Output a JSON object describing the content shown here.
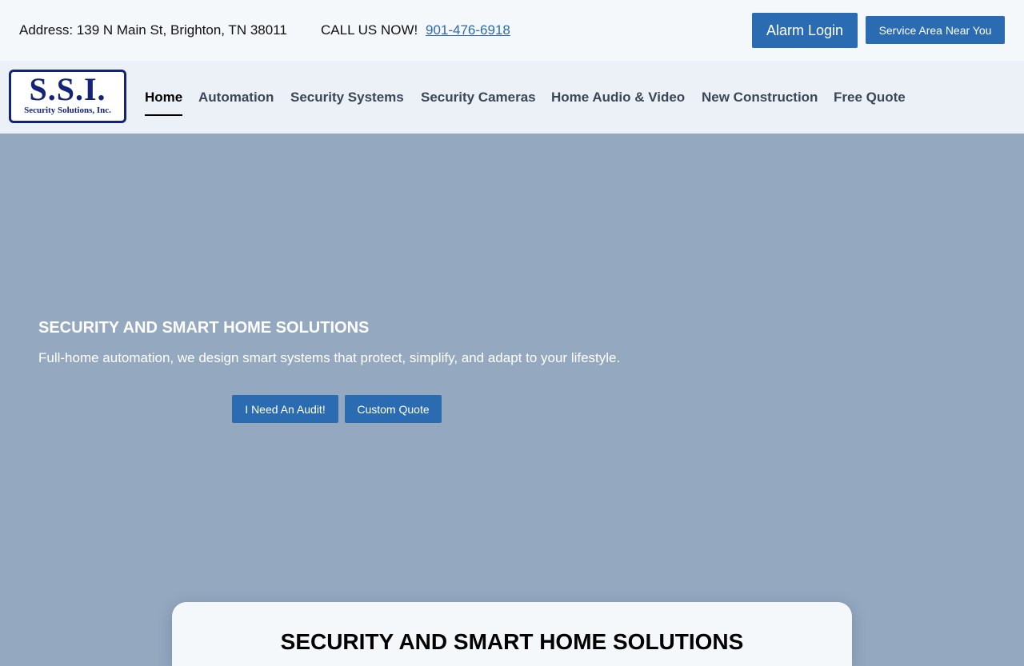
{
  "topbar": {
    "address": "Address: 139 N Main St, Brighton, TN 38011",
    "call_label": "CALL US NOW!",
    "phone": "901-476-6918",
    "alarm_login": "Alarm Login",
    "service_area": "Service Area Near You"
  },
  "logo": {
    "mark": "S.S.I.",
    "sub": "Security Solutions, Inc."
  },
  "nav": {
    "items": [
      {
        "label": "Home",
        "active": true
      },
      {
        "label": "Automation"
      },
      {
        "label": "Security Systems"
      },
      {
        "label": "Security Cameras"
      },
      {
        "label": "Home Audio & Video"
      },
      {
        "label": "New Construction"
      },
      {
        "label": "Free Quote"
      }
    ]
  },
  "hero": {
    "title": "SECURITY AND SMART HOME SOLUTIONS",
    "subtitle": "Full-home automation, we design smart systems that protect, simplify, and adapt to your lifestyle.",
    "audit_button": "I Need An Audit!",
    "quote_button": "Custom Quote",
    "background_color": "#94a8c0"
  },
  "card": {
    "title": "SECURITY AND SMART HOME SOLUTIONS"
  },
  "colors": {
    "accent": "#2a6bb1",
    "link": "#2d6aad",
    "logo": "#14237a"
  }
}
